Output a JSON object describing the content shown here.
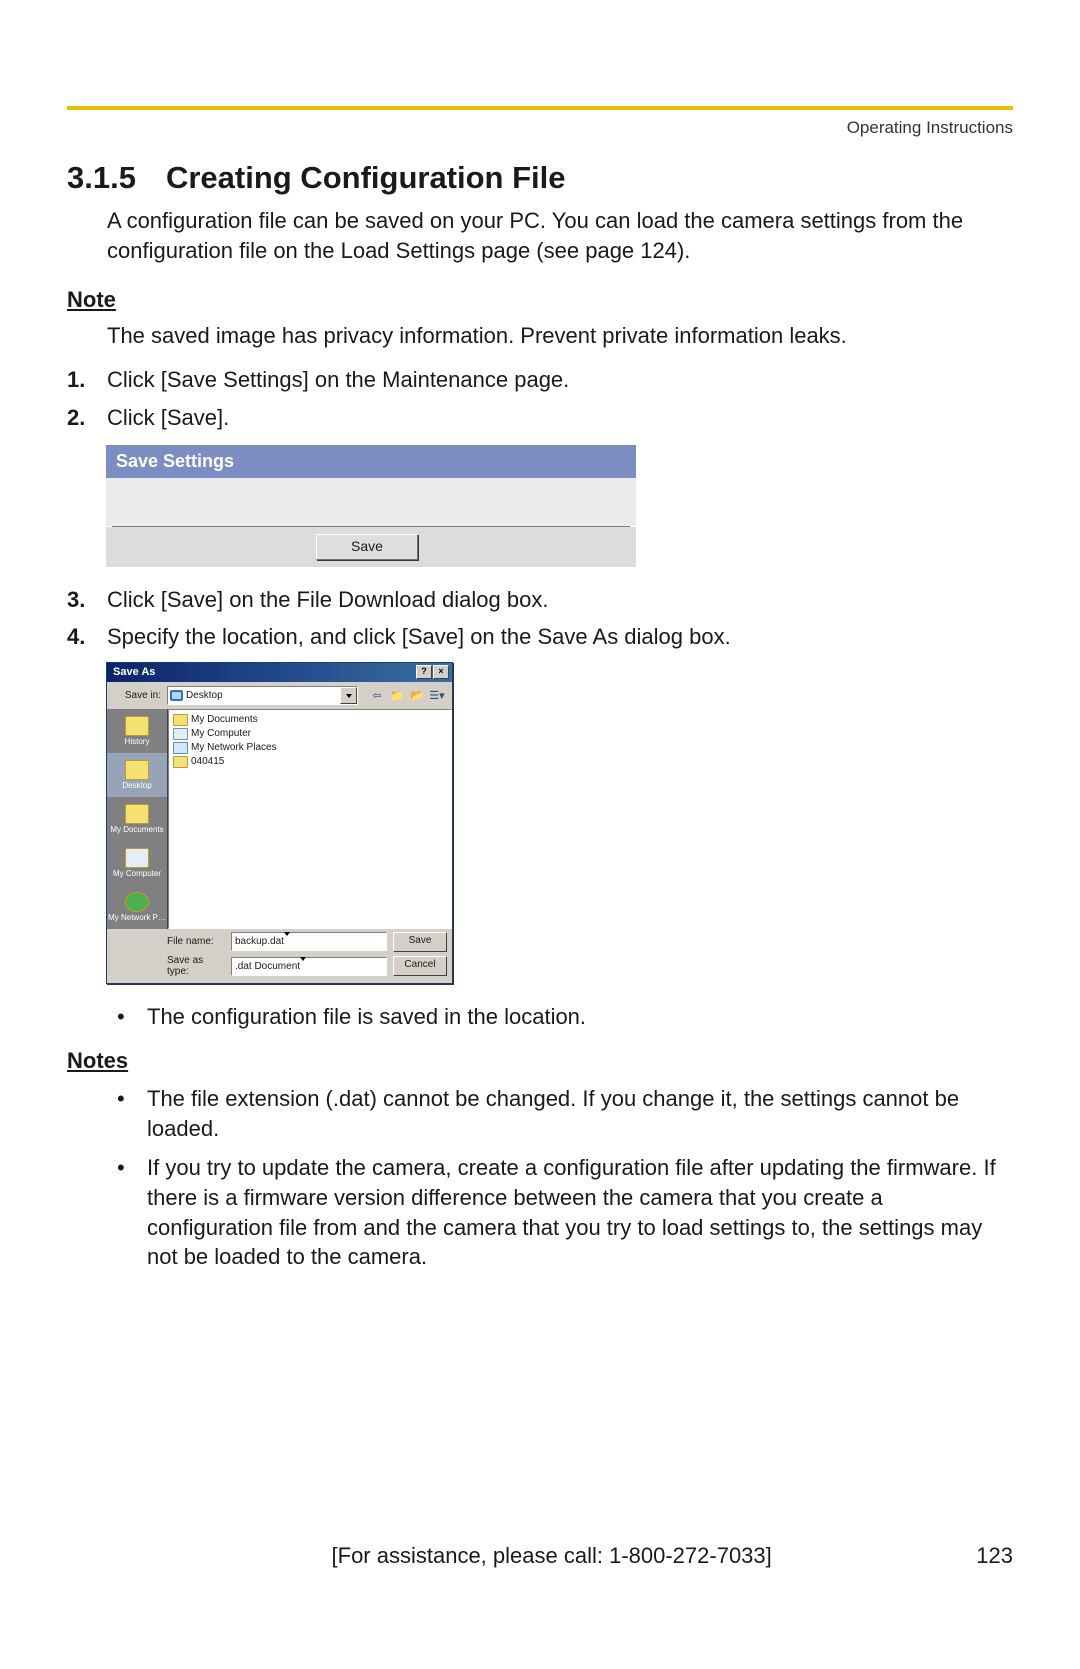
{
  "header": {
    "running_head": "Operating Instructions"
  },
  "section": {
    "number": "3.1.5",
    "title": "Creating Configuration File"
  },
  "intro": "A configuration file can be saved on your PC. You can load the camera settings from the configuration file on the Load Settings page (see page 124).",
  "note_label": "Note",
  "note_text": "The saved image has privacy information. Prevent private information leaks.",
  "steps": [
    "Click [Save Settings] on the Maintenance page.",
    "Click [Save].",
    "Click [Save] on the File Download dialog box.",
    "Specify the location, and click [Save] on the Save As dialog box."
  ],
  "ui_panel": {
    "title": "Save Settings",
    "save_btn": "Save"
  },
  "saveas": {
    "title": "Save As",
    "savein_label": "Save in:",
    "savein_value": "Desktop",
    "places": [
      {
        "key": "history",
        "label": "History"
      },
      {
        "key": "desktop",
        "label": "Desktop"
      },
      {
        "key": "mydocuments",
        "label": "My Documents"
      },
      {
        "key": "mycomputer",
        "label": "My Computer"
      },
      {
        "key": "mynetwork",
        "label": "My Network P…"
      }
    ],
    "files": [
      {
        "icon": "folder",
        "name": "My Documents"
      },
      {
        "icon": "comp",
        "name": "My Computer"
      },
      {
        "icon": "net",
        "name": "My Network Places"
      },
      {
        "icon": "folder",
        "name": "040415"
      }
    ],
    "filename_label": "File name:",
    "filename_value": "backup.dat",
    "saveastype_label": "Save as type:",
    "saveastype_value": ".dat Document",
    "save_btn": "Save",
    "cancel_btn": "Cancel"
  },
  "after_dialog_bullet": "The configuration file is saved in the location.",
  "notes_label": "Notes",
  "notes": [
    "The file extension (.dat) cannot be changed. If you change it, the settings cannot be loaded.",
    "If you try to update the camera, create a configuration file after updating the firmware. If there is a firmware version difference between the camera that you create a configuration file from and the camera that you try to load settings to, the settings may not be loaded to the camera."
  ],
  "footer": {
    "assistance": "[For assistance, please call: 1-800-272-7033]",
    "page": "123"
  }
}
